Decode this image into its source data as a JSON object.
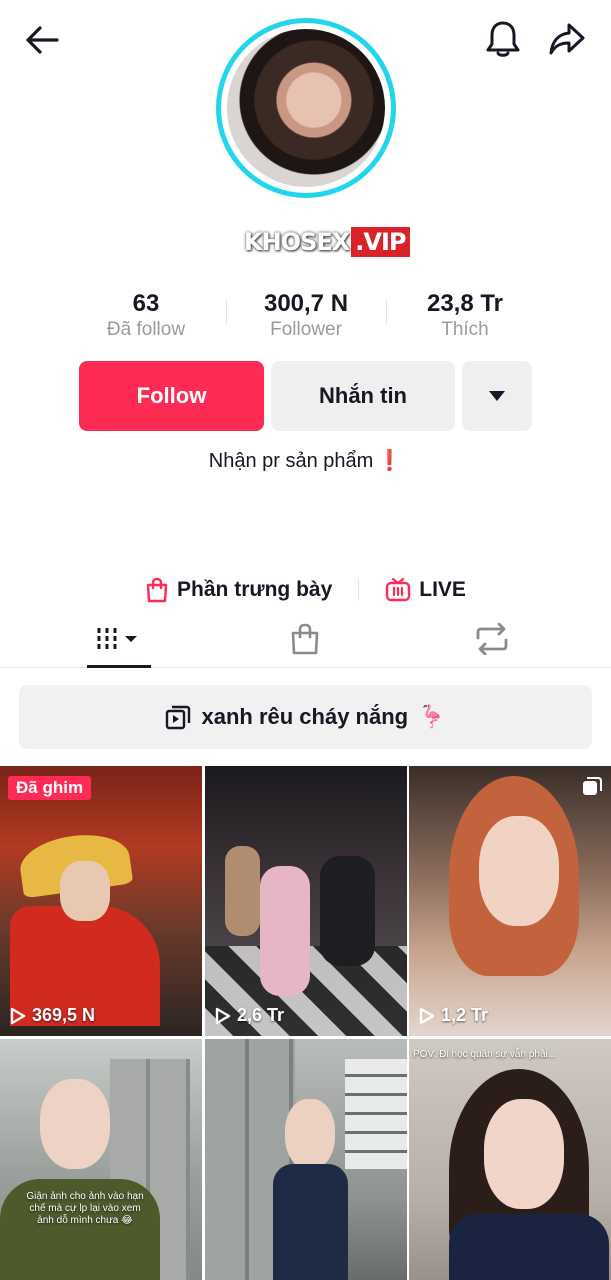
{
  "header": {
    "back_icon": "arrow-left-icon",
    "bell_icon": "bell-icon",
    "share_icon": "share-arrow-icon"
  },
  "profile": {
    "watermark_main": "KHOSEX",
    "watermark_suffix": ".VIP",
    "ring_color": "#20d5ec"
  },
  "stats": [
    {
      "value": "63",
      "label": "Đã follow"
    },
    {
      "value": "300,7 N",
      "label": "Follower"
    },
    {
      "value": "23,8 Tr",
      "label": "Thích"
    }
  ],
  "actions": {
    "follow_label": "Follow",
    "message_label": "Nhắn tin",
    "more_icon": "caret-down-icon",
    "follow_color": "#fe2c55"
  },
  "bio": {
    "text": "Nhận pr sản phẩm",
    "emoji": "❗"
  },
  "links": {
    "showcase_label": "Phần trưng bày",
    "showcase_icon": "shopping-bag-icon",
    "live_label": "LIVE",
    "live_icon": "live-tv-icon"
  },
  "tabs": {
    "videos_icon": "video-grid-icon",
    "shop_icon": "shopping-bag-icon",
    "repost_icon": "repost-icon"
  },
  "playlist": {
    "icon": "playlist-icon",
    "label": "xanh rêu cháy nắng",
    "emoji": "🦩"
  },
  "videos": [
    {
      "views": "369,5 N",
      "pinned_label": "Đã ghim"
    },
    {
      "views": "2,6 Tr"
    },
    {
      "views": "1,2 Tr"
    },
    {
      "views": "",
      "caption": "Giận ảnh cho ảnh vào hạn chế mà cự lp lại vào xem ảnh dỗ mình chưa 😂"
    },
    {
      "views": ""
    },
    {
      "views": "",
      "caption": "POV: Đi học quân sự vẫn phải..."
    }
  ]
}
